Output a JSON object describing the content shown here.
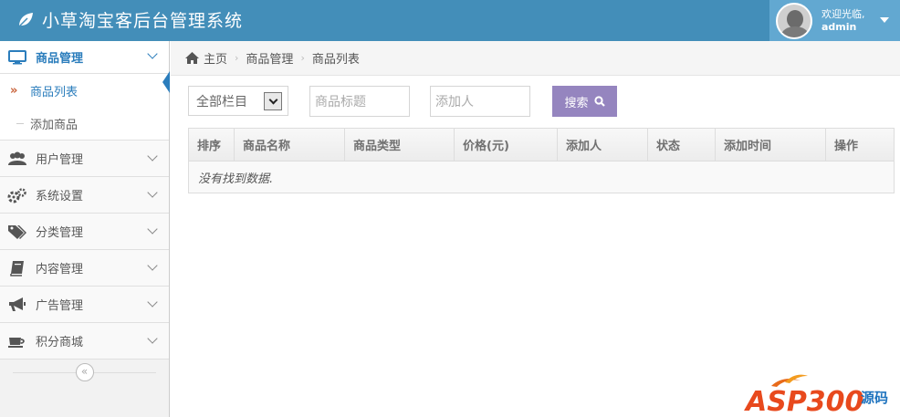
{
  "header": {
    "title": "小草淘宝客后台管理系统",
    "welcome": "欢迎光临,",
    "username": "admin"
  },
  "sidebar": {
    "items": [
      {
        "label": "商品管理",
        "icon": "desktop-icon",
        "expanded": true,
        "children": [
          {
            "label": "商品列表",
            "active": true
          },
          {
            "label": "添加商品",
            "active": false
          }
        ]
      },
      {
        "label": "用户管理",
        "icon": "users-icon"
      },
      {
        "label": "系统设置",
        "icon": "gears-icon"
      },
      {
        "label": "分类管理",
        "icon": "tags-icon"
      },
      {
        "label": "内容管理",
        "icon": "book-icon"
      },
      {
        "label": "广告管理",
        "icon": "bullhorn-icon"
      },
      {
        "label": "积分商城",
        "icon": "coffee-icon"
      }
    ],
    "collapse_glyph": "«"
  },
  "breadcrumb": {
    "home": "主页",
    "level1": "商品管理",
    "level2": "商品列表"
  },
  "filters": {
    "category_value": "全部栏目",
    "title_placeholder": "商品标题",
    "adder_placeholder": "添加人",
    "search_label": "搜索"
  },
  "table": {
    "columns": [
      "排序",
      "商品名称",
      "商品类型",
      "价格(元)",
      "添加人",
      "状态",
      "添加时间",
      "操作"
    ],
    "empty_text": "没有找到数据."
  },
  "watermark": {
    "brand": "ASP300",
    "suffix": "源码"
  },
  "colors": {
    "header_bg": "#438eb9",
    "user_bg": "#62a8d1",
    "active_blue": "#2b7dbc",
    "search_btn": "#9585bf"
  }
}
